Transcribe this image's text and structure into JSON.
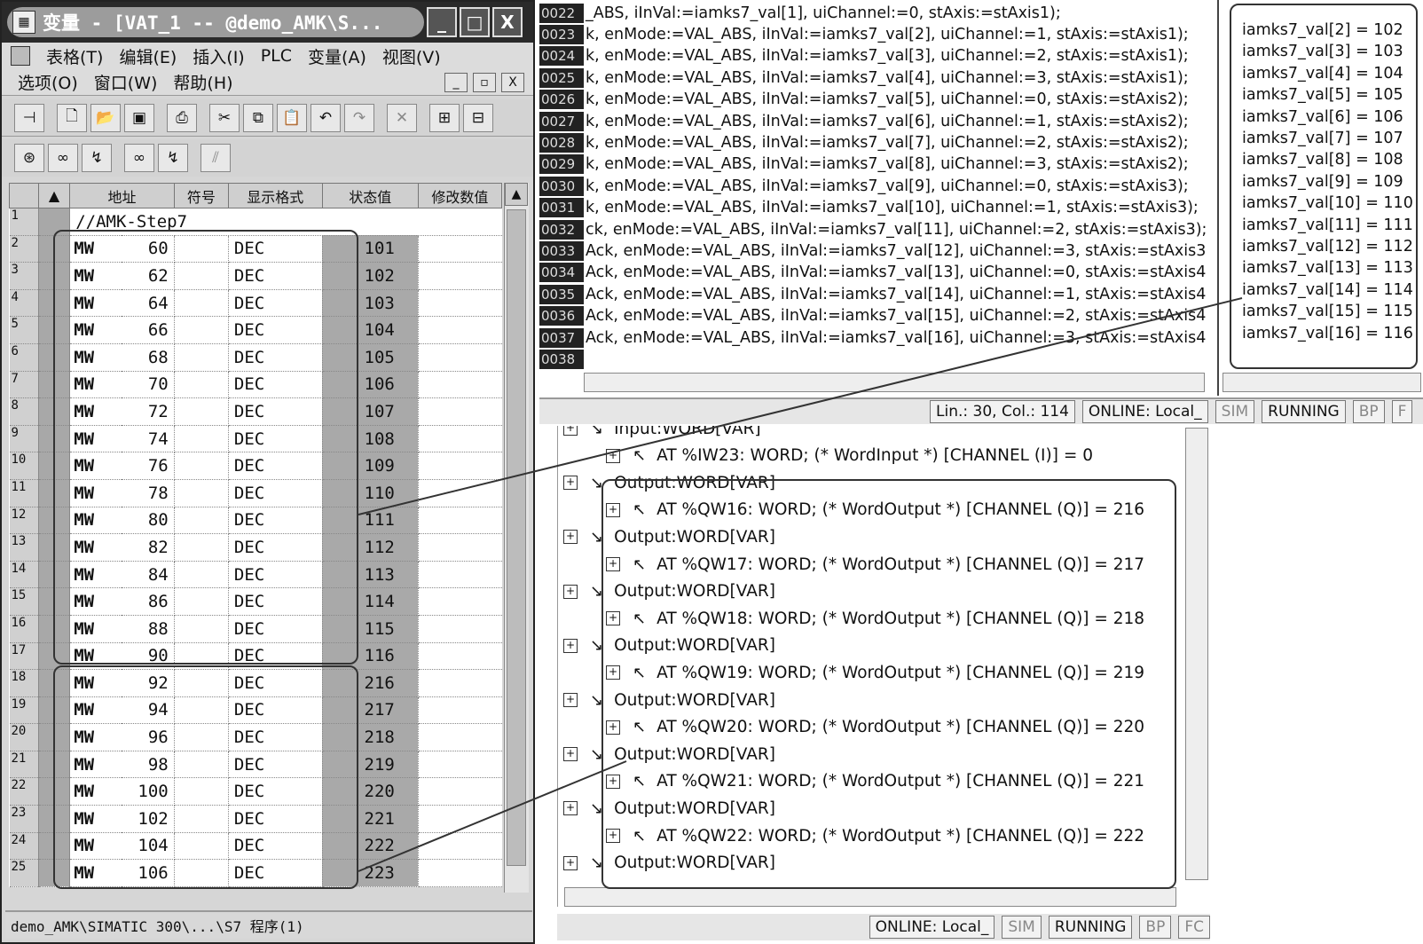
{
  "left_window": {
    "title": "变量 - [VAT_1 -- @demo_AMK\\S...",
    "window_buttons": [
      "_",
      "□",
      "X"
    ],
    "menu1": [
      "表格(T)",
      "编辑(E)",
      "插入(I)",
      "PLC",
      "变量(A)",
      "视图(V)"
    ],
    "menu2": [
      "选项(O)",
      "窗口(W)",
      "帮助(H)"
    ],
    "mdi_controls": [
      "_",
      "▫",
      "X"
    ],
    "columns": [
      "地址",
      "符号",
      "显示格式",
      "状态值",
      "修改数值"
    ],
    "comment_row": "//AMK-Step7",
    "rows": [
      {
        "n": "2",
        "op": "MW",
        "addr": "60",
        "fmt": "DEC",
        "status": "101"
      },
      {
        "n": "3",
        "op": "MW",
        "addr": "62",
        "fmt": "DEC",
        "status": "102"
      },
      {
        "n": "4",
        "op": "MW",
        "addr": "64",
        "fmt": "DEC",
        "status": "103"
      },
      {
        "n": "5",
        "op": "MW",
        "addr": "66",
        "fmt": "DEC",
        "status": "104"
      },
      {
        "n": "6",
        "op": "MW",
        "addr": "68",
        "fmt": "DEC",
        "status": "105"
      },
      {
        "n": "7",
        "op": "MW",
        "addr": "70",
        "fmt": "DEC",
        "status": "106"
      },
      {
        "n": "8",
        "op": "MW",
        "addr": "72",
        "fmt": "DEC",
        "status": "107"
      },
      {
        "n": "9",
        "op": "MW",
        "addr": "74",
        "fmt": "DEC",
        "status": "108"
      },
      {
        "n": "10",
        "op": "MW",
        "addr": "76",
        "fmt": "DEC",
        "status": "109"
      },
      {
        "n": "11",
        "op": "MW",
        "addr": "78",
        "fmt": "DEC",
        "status": "110"
      },
      {
        "n": "12",
        "op": "MW",
        "addr": "80",
        "fmt": "DEC",
        "status": "111"
      },
      {
        "n": "13",
        "op": "MW",
        "addr": "82",
        "fmt": "DEC",
        "status": "112"
      },
      {
        "n": "14",
        "op": "MW",
        "addr": "84",
        "fmt": "DEC",
        "status": "113"
      },
      {
        "n": "15",
        "op": "MW",
        "addr": "86",
        "fmt": "DEC",
        "status": "114"
      },
      {
        "n": "16",
        "op": "MW",
        "addr": "88",
        "fmt": "DEC",
        "status": "115"
      },
      {
        "n": "17",
        "op": "MW",
        "addr": "90",
        "fmt": "DEC",
        "status": "116"
      },
      {
        "n": "18",
        "op": "MW",
        "addr": "92",
        "fmt": "DEC",
        "status": "216"
      },
      {
        "n": "19",
        "op": "MW",
        "addr": "94",
        "fmt": "DEC",
        "status": "217"
      },
      {
        "n": "20",
        "op": "MW",
        "addr": "96",
        "fmt": "DEC",
        "status": "218"
      },
      {
        "n": "21",
        "op": "MW",
        "addr": "98",
        "fmt": "DEC",
        "status": "219"
      },
      {
        "n": "22",
        "op": "MW",
        "addr": "100",
        "fmt": "DEC",
        "status": "220"
      },
      {
        "n": "23",
        "op": "MW",
        "addr": "102",
        "fmt": "DEC",
        "status": "221"
      },
      {
        "n": "24",
        "op": "MW",
        "addr": "104",
        "fmt": "DEC",
        "status": "222"
      },
      {
        "n": "25",
        "op": "MW",
        "addr": "106",
        "fmt": "DEC",
        "status": "223"
      }
    ],
    "statusbar": "demo_AMK\\SIMATIC 300\\...\\S7 程序(1)"
  },
  "code_editor": {
    "lines": [
      {
        "n": "0022",
        "text": "_ABS, iInVal:=iamks7_val[1], uiChannel:=0, stAxis:=stAxis1);"
      },
      {
        "n": "0023",
        "text": "k, enMode:=VAL_ABS, iInVal:=iamks7_val[2], uiChannel:=1, stAxis:=stAxis1);"
      },
      {
        "n": "0024",
        "text": "k, enMode:=VAL_ABS, iInVal:=iamks7_val[3], uiChannel:=2, stAxis:=stAxis1);"
      },
      {
        "n": "0025",
        "text": "k, enMode:=VAL_ABS, iInVal:=iamks7_val[4], uiChannel:=3, stAxis:=stAxis1);"
      },
      {
        "n": "0026",
        "text": "k, enMode:=VAL_ABS, iInVal:=iamks7_val[5], uiChannel:=0, stAxis:=stAxis2);"
      },
      {
        "n": "0027",
        "text": "k, enMode:=VAL_ABS, iInVal:=iamks7_val[6], uiChannel:=1, stAxis:=stAxis2);"
      },
      {
        "n": "0028",
        "text": "k, enMode:=VAL_ABS, iInVal:=iamks7_val[7], uiChannel:=2, stAxis:=stAxis2);"
      },
      {
        "n": "0029",
        "text": "k, enMode:=VAL_ABS, iInVal:=iamks7_val[8], uiChannel:=3, stAxis:=stAxis2);"
      },
      {
        "n": "0030",
        "text": "k, enMode:=VAL_ABS, iInVal:=iamks7_val[9], uiChannel:=0, stAxis:=stAxis3);"
      },
      {
        "n": "0031",
        "text": "k, enMode:=VAL_ABS, iInVal:=iamks7_val[10], uiChannel:=1, stAxis:=stAxis3);"
      },
      {
        "n": "0032",
        "text": "ck, enMode:=VAL_ABS, iInVal:=iamks7_val[11], uiChannel:=2, stAxis:=stAxis3);"
      },
      {
        "n": "0033",
        "text": "Ack, enMode:=VAL_ABS, iInVal:=iamks7_val[12], uiChannel:=3, stAxis:=stAxis3"
      },
      {
        "n": "0034",
        "text": "Ack, enMode:=VAL_ABS, iInVal:=iamks7_val[13], uiChannel:=0, stAxis:=stAxis4"
      },
      {
        "n": "0035",
        "text": "Ack, enMode:=VAL_ABS, iInVal:=iamks7_val[14], uiChannel:=1, stAxis:=stAxis4"
      },
      {
        "n": "0036",
        "text": "Ack, enMode:=VAL_ABS, iInVal:=iamks7_val[15], uiChannel:=2, stAxis:=stAxis4"
      },
      {
        "n": "0037",
        "text": "Ack, enMode:=VAL_ABS, iInVal:=iamks7_val[16], uiChannel:=3, stAxis:=stAxis4"
      },
      {
        "n": "0038",
        "text": ""
      }
    ]
  },
  "watch": {
    "lines": [
      "iamks7_val[2] = 102",
      "iamks7_val[3] = 103",
      "iamks7_val[4] = 104",
      "iamks7_val[5] = 105",
      "iamks7_val[6] = 106",
      "iamks7_val[7] = 107",
      "iamks7_val[8] = 108",
      "iamks7_val[9] = 109",
      "iamks7_val[10] = 110",
      "iamks7_val[11] = 111",
      "iamks7_val[12] = 112",
      "iamks7_val[13] = 113",
      "iamks7_val[14] = 114",
      "iamks7_val[15] = 115",
      "iamks7_val[16] = 116"
    ]
  },
  "status_top": [
    "Lin.: 30, Col.: 114",
    "ONLINE: Local_",
    "SIM",
    "RUNNING",
    "BP",
    "F"
  ],
  "tree": {
    "lines": [
      {
        "kind": "group",
        "text": "Input:WORD[VAR]"
      },
      {
        "kind": "leaf",
        "text": "AT %IW23: WORD; (* WordInput *) [CHANNEL (I)] = 0"
      },
      {
        "kind": "group",
        "text": "Output:WORD[VAR]"
      },
      {
        "kind": "leaf",
        "text": "AT %QW16: WORD; (* WordOutput *) [CHANNEL (Q)] = 216"
      },
      {
        "kind": "group",
        "text": "Output:WORD[VAR]"
      },
      {
        "kind": "leaf",
        "text": "AT %QW17: WORD; (* WordOutput *) [CHANNEL (Q)] = 217"
      },
      {
        "kind": "group",
        "text": "Output:WORD[VAR]"
      },
      {
        "kind": "leaf",
        "text": "AT %QW18: WORD; (* WordOutput *) [CHANNEL (Q)] = 218"
      },
      {
        "kind": "group",
        "text": "Output:WORD[VAR]"
      },
      {
        "kind": "leaf",
        "text": "AT %QW19: WORD; (* WordOutput *) [CHANNEL (Q)] = 219"
      },
      {
        "kind": "group",
        "text": "Output:WORD[VAR]"
      },
      {
        "kind": "leaf",
        "text": "AT %QW20: WORD; (* WordOutput *) [CHANNEL (Q)] = 220"
      },
      {
        "kind": "group",
        "text": "Output:WORD[VAR]"
      },
      {
        "kind": "leaf",
        "text": "AT %QW21: WORD; (* WordOutput *) [CHANNEL (Q)] = 221"
      },
      {
        "kind": "group",
        "text": "Output:WORD[VAR]"
      },
      {
        "kind": "leaf",
        "text": "AT %QW22: WORD; (* WordOutput *) [CHANNEL (Q)] = 222"
      },
      {
        "kind": "group",
        "text": "Output:WORD[VAR]"
      }
    ]
  },
  "status_bottom": [
    "ONLINE: Local_",
    "SIM",
    "RUNNING",
    "BP",
    "FC"
  ]
}
